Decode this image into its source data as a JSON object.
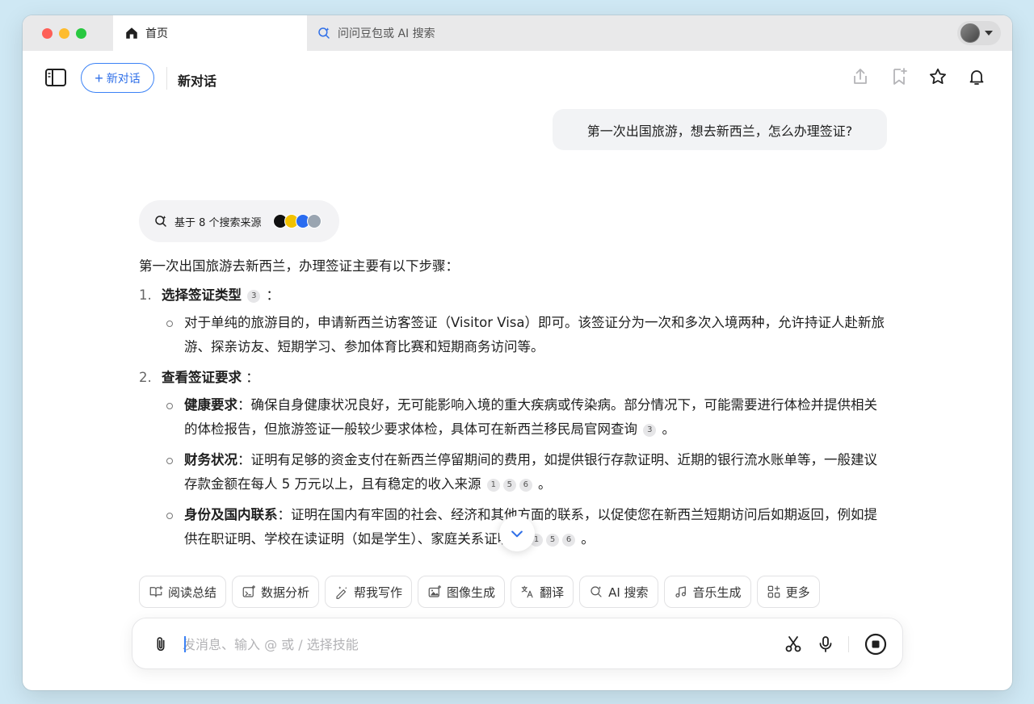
{
  "tabs": [
    {
      "label": "首页",
      "icon": "home-icon",
      "active": true
    },
    {
      "label": "问问豆包或 AI 搜索",
      "icon": "ai-search-icon",
      "active": false
    }
  ],
  "header": {
    "new_chat_label": "新对话",
    "title": "新对话"
  },
  "user_message": "第一次出国旅游，想去新西兰，怎么办理签证?",
  "sources": {
    "label": "基于 8 个搜索来源",
    "logo_colors": [
      "#111111",
      "#f2c200",
      "#2a6cf0",
      "#9aa5b1"
    ]
  },
  "answer": {
    "intro": "第一次出国旅游去新西兰，办理签证主要有以下步骤：",
    "steps": [
      {
        "num": "1.",
        "title": "选择签证类型",
        "cite": "3",
        "suffix": "：",
        "subs": [
          {
            "text": "对于单纯的旅游目的，申请新西兰访客签证（Visitor Visa）即可。该签证分为一次和多次入境两种，允许持证人赴新旅游、探亲访友、短期学习、参加体育比赛和短期商务访问等。"
          }
        ]
      },
      {
        "num": "2.",
        "title": "查看签证要求",
        "suffix": "：",
        "subs": [
          {
            "bold": "健康要求",
            "text": "：确保自身健康状况良好，无可能影响入境的重大疾病或传染病。部分情况下，可能需要进行体检并提供相关的体检报告，但旅游签证一般较少要求体检，具体可在新西兰移民局官网查询",
            "cites": [
              "3"
            ],
            "end": "。"
          },
          {
            "bold": "财务状况",
            "text": "：证明有足够的资金支付在新西兰停留期间的费用，如提供银行存款证明、近期的银行流水账单等，一般建议存款金额在每人 5 万元以上，且有稳定的收入来源",
            "cites": [
              "1",
              "5",
              "6"
            ],
            "end": "。"
          },
          {
            "bold": "身份及国内联系",
            "text": "：证明在国内有牢固的社会、经济和其他方面的联系，以促使您在新西兰短期访问后如期返回，例如提供在职证明、学校在读证明（如是学生）、家庭关系证明等",
            "cites": [
              "1",
              "5",
              "6"
            ],
            "end": "。"
          }
        ]
      }
    ]
  },
  "skills": [
    {
      "label": "阅读总结",
      "icon": "read-summary-icon"
    },
    {
      "label": "数据分析",
      "icon": "data-analysis-icon"
    },
    {
      "label": "帮我写作",
      "icon": "writing-icon"
    },
    {
      "label": "图像生成",
      "icon": "image-gen-icon"
    },
    {
      "label": "翻译",
      "icon": "translate-icon"
    },
    {
      "label": "AI 搜索",
      "icon": "ai-search-icon"
    },
    {
      "label": "音乐生成",
      "icon": "music-icon"
    },
    {
      "label": "更多",
      "icon": "more-grid-icon"
    }
  ],
  "composer": {
    "placeholder": "发消息、输入 @ 或 / 选择技能"
  },
  "colors": {
    "accent": "#2f6fe8",
    "bubble": "#f2f3f5",
    "window_bg": "#cfe8f4"
  }
}
